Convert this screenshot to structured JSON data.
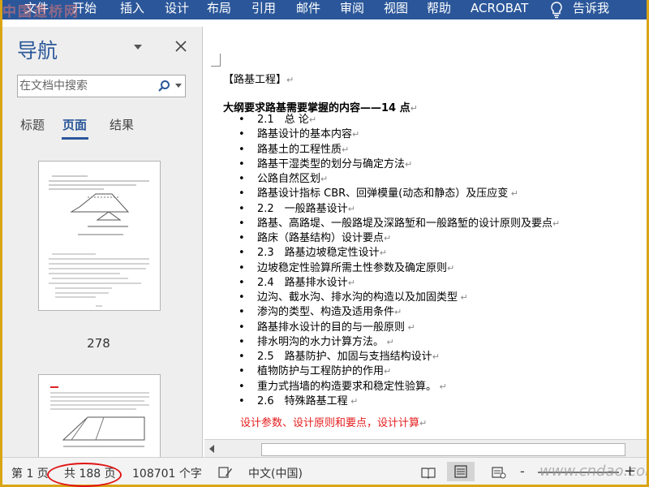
{
  "ribbon": {
    "watermark": "中国造桥网",
    "tabs": [
      "文件",
      "开始",
      "插入",
      "设计",
      "布局",
      "引用",
      "邮件",
      "审阅",
      "视图",
      "帮助",
      "ACROBAT"
    ],
    "tell_me": "告诉我",
    "bg_color": "#2b579a"
  },
  "nav": {
    "title": "导航",
    "search_placeholder": "在文档中搜索",
    "tabs": [
      "标题",
      "页面",
      "结果"
    ],
    "active_tab": "页面",
    "thumbnails": [
      {
        "page_label": "278"
      },
      {
        "page_label": ""
      }
    ]
  },
  "doc": {
    "heading": "【路基工程】",
    "subheading": "大纲要求路基需要掌握的内容——14 点",
    "items": [
      "2.1　总 论",
      "路基设计的基本内容",
      "路基土的工程性质",
      "路基干湿类型的划分与确定方法",
      "公路自然区划",
      "路基设计指标 CBR、回弹模量(动态和静态）及压应变",
      "2.2　一般路基设计",
      "路基、高路堤、一般路堤及深路堑和一般路堑的设计原则及要点",
      "路床（路基结构）设计要点",
      "2.3　路基边坡稳定性设计",
      "边坡稳定性验算所需土性参数及确定原则",
      "2.4　路基排水设计",
      "边沟、截水沟、排水沟的构造以及加固类型",
      "渗沟的类型、构造及适用条件",
      "路基排水设计的目的与一般原则",
      "排水明沟的水力计算方法。",
      "2.5　路基防护、加固与支挡结构设计",
      "植物防护与工程防护的作用",
      "重力式挡墙的构造要求和稳定性验算。",
      "2.6　特殊路基工程"
    ],
    "red_line": "设计参数、设计原则和要点，设计计算",
    "red_color": "#e51c1c"
  },
  "status": {
    "page": "第 1 页",
    "total": "共 188 页",
    "words": "108701 个字",
    "language": "中文(中国)",
    "watermark": "www.cndao.com",
    "zoom_minus": "-",
    "zoom_plus": "+"
  }
}
